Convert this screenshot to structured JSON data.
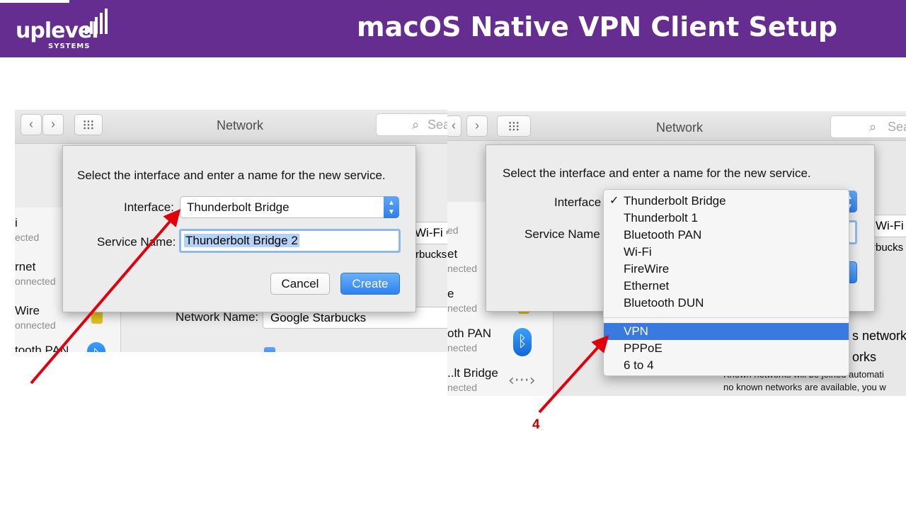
{
  "header": {
    "logo_word": "uplevel",
    "logo_sub": "SYSTEMS",
    "title": "macOS Native VPN Client Setup",
    "background": "#662d91"
  },
  "left_screenshot": {
    "toolbar": {
      "back_glyph": "‹",
      "forward_glyph": "›",
      "title": "Network",
      "search_placeholder": "Sea"
    },
    "sidebar": [
      {
        "name": "i",
        "status": "ected"
      },
      {
        "name": "rnet",
        "status": "onnected"
      },
      {
        "name": "Wire",
        "status": "onnected"
      },
      {
        "name": "tooth PAN",
        "status": ""
      }
    ],
    "dialog": {
      "prompt": "Select the interface and enter a name for the new service.",
      "interface_label": "Interface:",
      "interface_value": "Thunderbolt Bridge",
      "service_name_label": "Service Name:",
      "service_name_value": "Thunderbolt Bridge 2",
      "cancel_label": "Cancel",
      "create_label": "Create"
    },
    "behind": {
      "wifi_popup_text": "Wi-Fi O",
      "starbucks_text": "rbucks",
      "network_name_label": "Network Name:",
      "network_name_value": "Google Starbucks"
    }
  },
  "right_screenshot": {
    "toolbar": {
      "back_glyph": "‹",
      "forward_glyph": "›",
      "title": "Network",
      "search_placeholder": "Sea"
    },
    "sidebar": [
      {
        "name": "",
        "status": "ed"
      },
      {
        "name": "et",
        "status": "nected"
      },
      {
        "name": "e",
        "status": "nected"
      },
      {
        "name": "oth PAN",
        "status": "nected"
      },
      {
        "name": "..lt Bridge",
        "status": "nected"
      }
    ],
    "dialog": {
      "prompt": "Select the interface and enter a name for the new service.",
      "interface_label": "Interface",
      "service_name_label": "Service Name"
    },
    "menu": {
      "checkmark": "✓",
      "items_group1": [
        "Thunderbolt Bridge",
        "Thunderbolt 1",
        "Bluetooth PAN",
        "Wi-Fi",
        "FireWire",
        "Ethernet",
        "Bluetooth DUN"
      ],
      "items_group2": [
        "VPN",
        "PPPoE",
        "6 to 4"
      ],
      "checked_item": "Thunderbolt Bridge",
      "highlighted_item": "VPN",
      "highlight_color": "#3a7ae0"
    },
    "behind": {
      "wifi_popup_text": "Wi-Fi O",
      "starbucks_text": "rbucks",
      "network_text": "s network",
      "works_text": "orks",
      "hint_line1": "Known networks will be joined automati",
      "hint_line2": "no known networks are available, you w"
    }
  },
  "annotation": {
    "step_number": "4",
    "arrow_color": "#e0000b"
  }
}
